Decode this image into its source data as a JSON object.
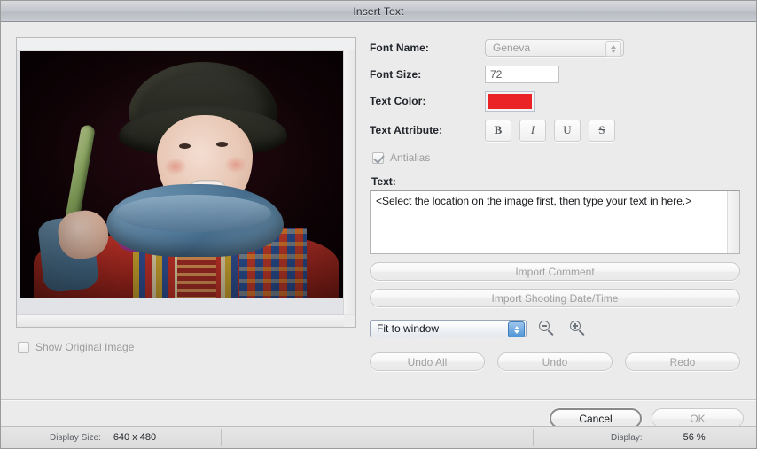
{
  "window": {
    "title": "Insert Text"
  },
  "preview": {
    "alt_text": "Child wearing dark hat, blue scarf and colorful red plaid jacket holding a green stick",
    "show_original_label": "Show Original Image",
    "show_original_checked": false
  },
  "form": {
    "font_name": {
      "label": "Font Name:",
      "value": "Geneva",
      "enabled": false
    },
    "font_size": {
      "label": "Font Size:",
      "value": "72",
      "enabled": true
    },
    "text_color": {
      "label": "Text Color:",
      "value": "#ea2327"
    },
    "text_attribute": {
      "label": "Text Attribute:",
      "buttons": [
        {
          "name": "bold",
          "glyph": "B"
        },
        {
          "name": "italic",
          "glyph": "I"
        },
        {
          "name": "underline",
          "glyph": "U"
        },
        {
          "name": "strikethrough",
          "glyph": "S"
        }
      ]
    },
    "antialias": {
      "label": "Antialias",
      "checked": true,
      "enabled": false
    },
    "text": {
      "label": "Text:",
      "value": "<Select the location on the image first, then type your text in here.>"
    }
  },
  "buttons": {
    "import_comment": "Import Comment",
    "import_shooting_date": "Import Shooting Date/Time",
    "undo_all": "Undo All",
    "undo": "Undo",
    "redo": "Redo",
    "cancel": "Cancel",
    "ok": "OK"
  },
  "zoom_controls": {
    "mode": "Fit to window",
    "zoom_out_icon": "magnifier-minus-icon",
    "zoom_in_icon": "magnifier-plus-icon"
  },
  "statusbar": {
    "display_size_label": "Display Size:",
    "display_size_value": "640 x 480",
    "display_label": "Display:",
    "display_value": "56 %"
  }
}
